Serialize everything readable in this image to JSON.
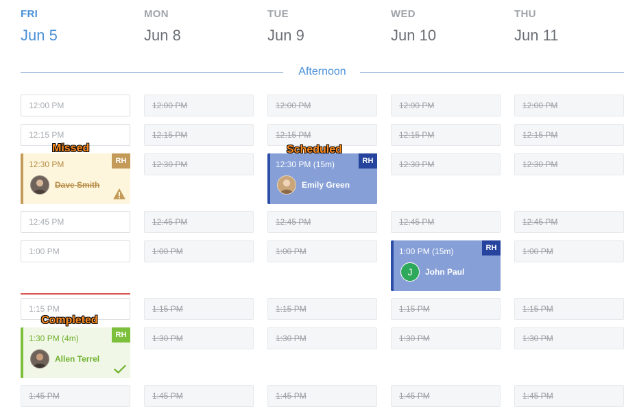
{
  "days": [
    {
      "name": "FRI",
      "date": "Jun 5",
      "today": true
    },
    {
      "name": "MON",
      "date": "Jun 8"
    },
    {
      "name": "TUE",
      "date": "Jun 9"
    },
    {
      "name": "WED",
      "date": "Jun 10"
    },
    {
      "name": "THU",
      "date": "Jun 11"
    }
  ],
  "section": {
    "label": "Afternoon"
  },
  "slots": {
    "fri": [
      {
        "time": "12:00 PM",
        "state": "available"
      },
      {
        "time": "12:15 PM",
        "state": "available"
      },
      {
        "time": "12:45 PM",
        "state": "available"
      },
      {
        "time": "1:00 PM",
        "state": "available"
      },
      {
        "time": "1:15 PM",
        "state": "available"
      },
      {
        "time": "1:45 PM",
        "state": "unavailable"
      }
    ],
    "mon": [
      "12:00 PM",
      "12:15 PM",
      "12:30 PM",
      "12:45 PM",
      "1:00 PM",
      "1:15 PM",
      "1:30 PM",
      "1:45 PM"
    ],
    "tue": [
      "12:00 PM",
      "12:15 PM",
      "12:45 PM",
      "1:00 PM",
      "1:15 PM",
      "1:30 PM",
      "1:45 PM"
    ],
    "wed": [
      "12:00 PM",
      "12:15 PM",
      "12:30 PM",
      "12:45 PM",
      "1:15 PM",
      "1:30 PM",
      "1:45 PM"
    ],
    "thu": [
      "12:00 PM",
      "12:15 PM",
      "12:30 PM",
      "12:45 PM",
      "1:00 PM",
      "1:15 PM",
      "1:30 PM",
      "1:45 PM"
    ]
  },
  "appointments": {
    "missed": {
      "time": "12:30 PM",
      "patient": "Dave Smith",
      "badge": "RH",
      "status_icon": "warning-icon",
      "color": "#c39a58"
    },
    "scheduled": {
      "time": "12:30 PM (15m)",
      "patient": "Emily Green",
      "badge": "RH",
      "color": "#2d4ea8"
    },
    "scheduled2": {
      "time": "1:00 PM (15m)",
      "patient": "John Paul",
      "initial": "J",
      "badge": "RH",
      "color": "#2d4ea8"
    },
    "completed": {
      "time": "1:30 PM (4m)",
      "patient": "Allen Terrel",
      "badge": "RH",
      "status_icon": "checkmark-icon",
      "color": "#7cbf3a"
    }
  },
  "annotations": {
    "missed": "Missed",
    "scheduled": "Scheduled",
    "completed": "Completed"
  },
  "colors": {
    "accent": "#4a90d9",
    "now_line": "#d9534f",
    "annotation": "#ff8a1d"
  }
}
